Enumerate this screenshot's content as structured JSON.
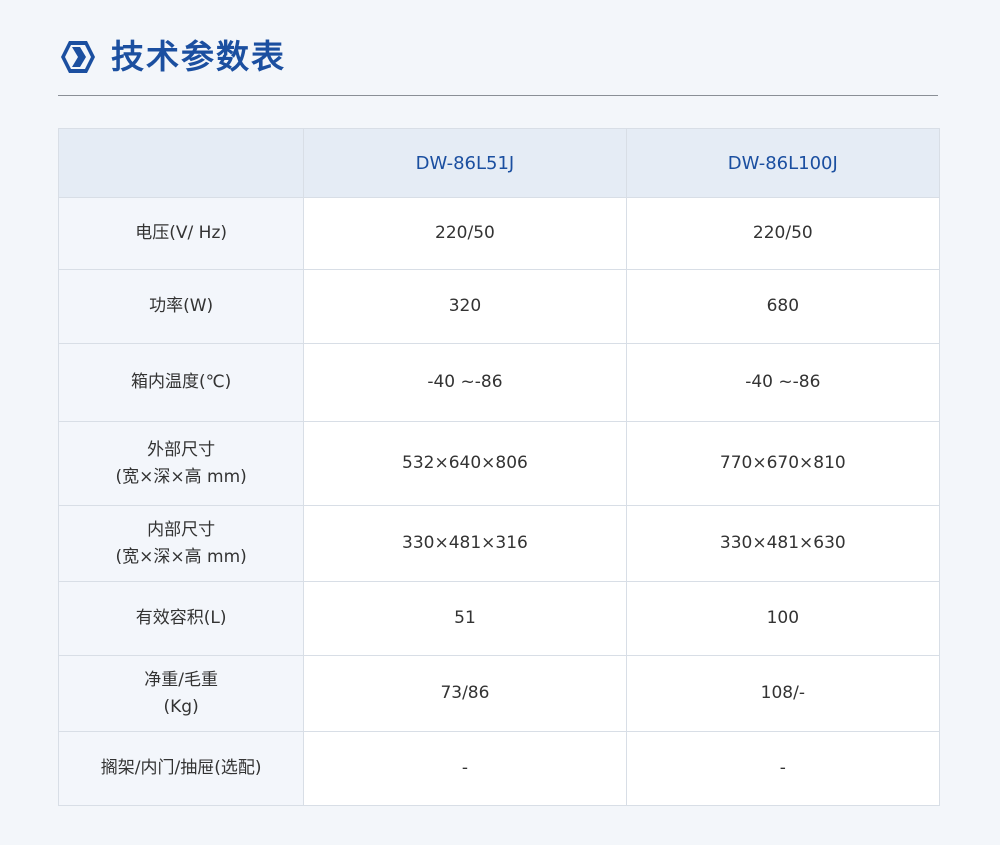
{
  "header": {
    "title": "技术参数表"
  },
  "table": {
    "columns": [
      "",
      "DW-86L51J",
      "DW-86L100J"
    ],
    "rows": [
      {
        "label": [
          "电压(V/ Hz)"
        ],
        "a": "220/50",
        "b": "220/50"
      },
      {
        "label": [
          "功率(W)"
        ],
        "a": "320",
        "b": "680"
      },
      {
        "label": [
          "箱内温度(℃)"
        ],
        "a": "-40 ~-86",
        "b": "-40 ~-86"
      },
      {
        "label": [
          "外部尺寸",
          "(宽×深×高 mm)"
        ],
        "a": "532×640×806",
        "b": "770×670×810"
      },
      {
        "label": [
          "内部尺寸",
          "(宽×深×高 mm)"
        ],
        "a": "330×481×316",
        "b": "330×481×630"
      },
      {
        "label": [
          "有效容积(L)"
        ],
        "a": "51",
        "b": "100"
      },
      {
        "label": [
          "净重/毛重",
          "(Kg)"
        ],
        "a": "73/86",
        "b": "108/-"
      },
      {
        "label": [
          "搁架/内门/抽屉(选配)"
        ],
        "a": "-",
        "b": "-"
      }
    ]
  },
  "colors": {
    "accent": "#1b4fa0",
    "header_bg": "#e5ecf5",
    "label_bg": "#f3f6fb",
    "border": "#d8dee6",
    "page_bg": "#f3f6fa"
  },
  "icons": {
    "title_icon": "hexagon-chevron-right-icon"
  }
}
